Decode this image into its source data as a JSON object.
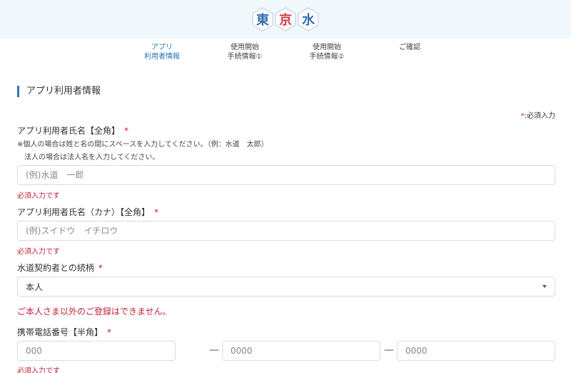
{
  "logo": {
    "chars": [
      "東",
      "京",
      "水"
    ]
  },
  "steps": [
    {
      "line1": "アプリ",
      "line2": "利用者情報",
      "active": true
    },
    {
      "line1": "使用開始",
      "line2": "手続情報①",
      "active": false
    },
    {
      "line1": "使用開始",
      "line2": "手続情報②",
      "active": false
    },
    {
      "line1": "ご確認",
      "line2": "",
      "active": false
    }
  ],
  "section": {
    "title": "アプリ利用者情報"
  },
  "required_note": {
    "star": "*",
    "text": ":必須入力"
  },
  "fields": {
    "name": {
      "label": "アプリ利用者氏名【全角】",
      "star": "*",
      "note1": "※個人の場合は姓と名の間にスペースを入力してください。（例：水道　太郎）",
      "note2": "法人の場合は法人名を入力してください。",
      "placeholder": "(例)水道　一郎",
      "error": "必須入力です"
    },
    "kana": {
      "label": "アプリ利用者氏名（カナ）【全角】",
      "star": "*",
      "placeholder": "(例)スイドウ　イチロウ",
      "error": "必須入力です"
    },
    "relation": {
      "label": "水道契約者との続柄",
      "star": "*",
      "selected": "本人",
      "warning": "ご本人さま以外のご登録はできません。"
    },
    "phone": {
      "label": "携帯電話番号【半角】",
      "star": "*",
      "placeholder1": "000",
      "placeholder2": "0000",
      "placeholder3": "0000",
      "separator": "—",
      "error": "必須入力です"
    }
  }
}
